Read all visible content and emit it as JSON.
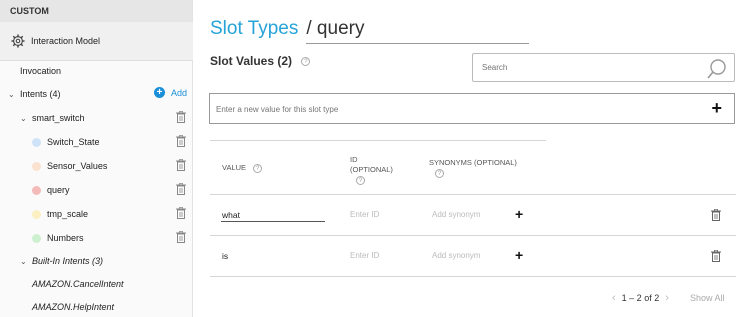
{
  "sidebar": {
    "header": "CUSTOM",
    "interaction_model": "Interaction Model",
    "invocation": "Invocation",
    "intents_label": "Intents (4)",
    "add_label": "Add",
    "intent": "smart_switch",
    "slot_types": [
      {
        "label": "Switch_State",
        "color": "#cfe3f8"
      },
      {
        "label": "Sensor_Values",
        "color": "#fbe1cf"
      },
      {
        "label": "query",
        "color": "#f4b9b9"
      },
      {
        "label": "tmp_scale",
        "color": "#fbf0c2"
      },
      {
        "label": "Numbers",
        "color": "#cdf0d0"
      }
    ],
    "builtin_label": "Built-In Intents (3)",
    "builtin_items": [
      "AMAZON.CancelIntent",
      "AMAZON.HelpIntent"
    ]
  },
  "page": {
    "title_prefix": "Slot Types",
    "title_name": "/ query",
    "slot_values_label": "Slot Values (2)",
    "search_placeholder": "Search",
    "new_value_placeholder": "Enter a new value for this slot type"
  },
  "table": {
    "col_value": "VALUE",
    "col_id_1": "ID",
    "col_id_2": "(OPTIONAL)",
    "col_syn": "SYNONYMS (OPTIONAL)",
    "rows": [
      {
        "value": "what",
        "id_placeholder": "Enter ID",
        "syn_placeholder": "Add synonym"
      },
      {
        "value": "is",
        "id_placeholder": "Enter ID",
        "syn_placeholder": "Add synonym"
      }
    ]
  },
  "pagination": {
    "range": "1 – 2 of 2",
    "show_all": "Show All"
  },
  "colors": {
    "accent": "#26a3d8",
    "add_blue": "#1a8fd8"
  }
}
